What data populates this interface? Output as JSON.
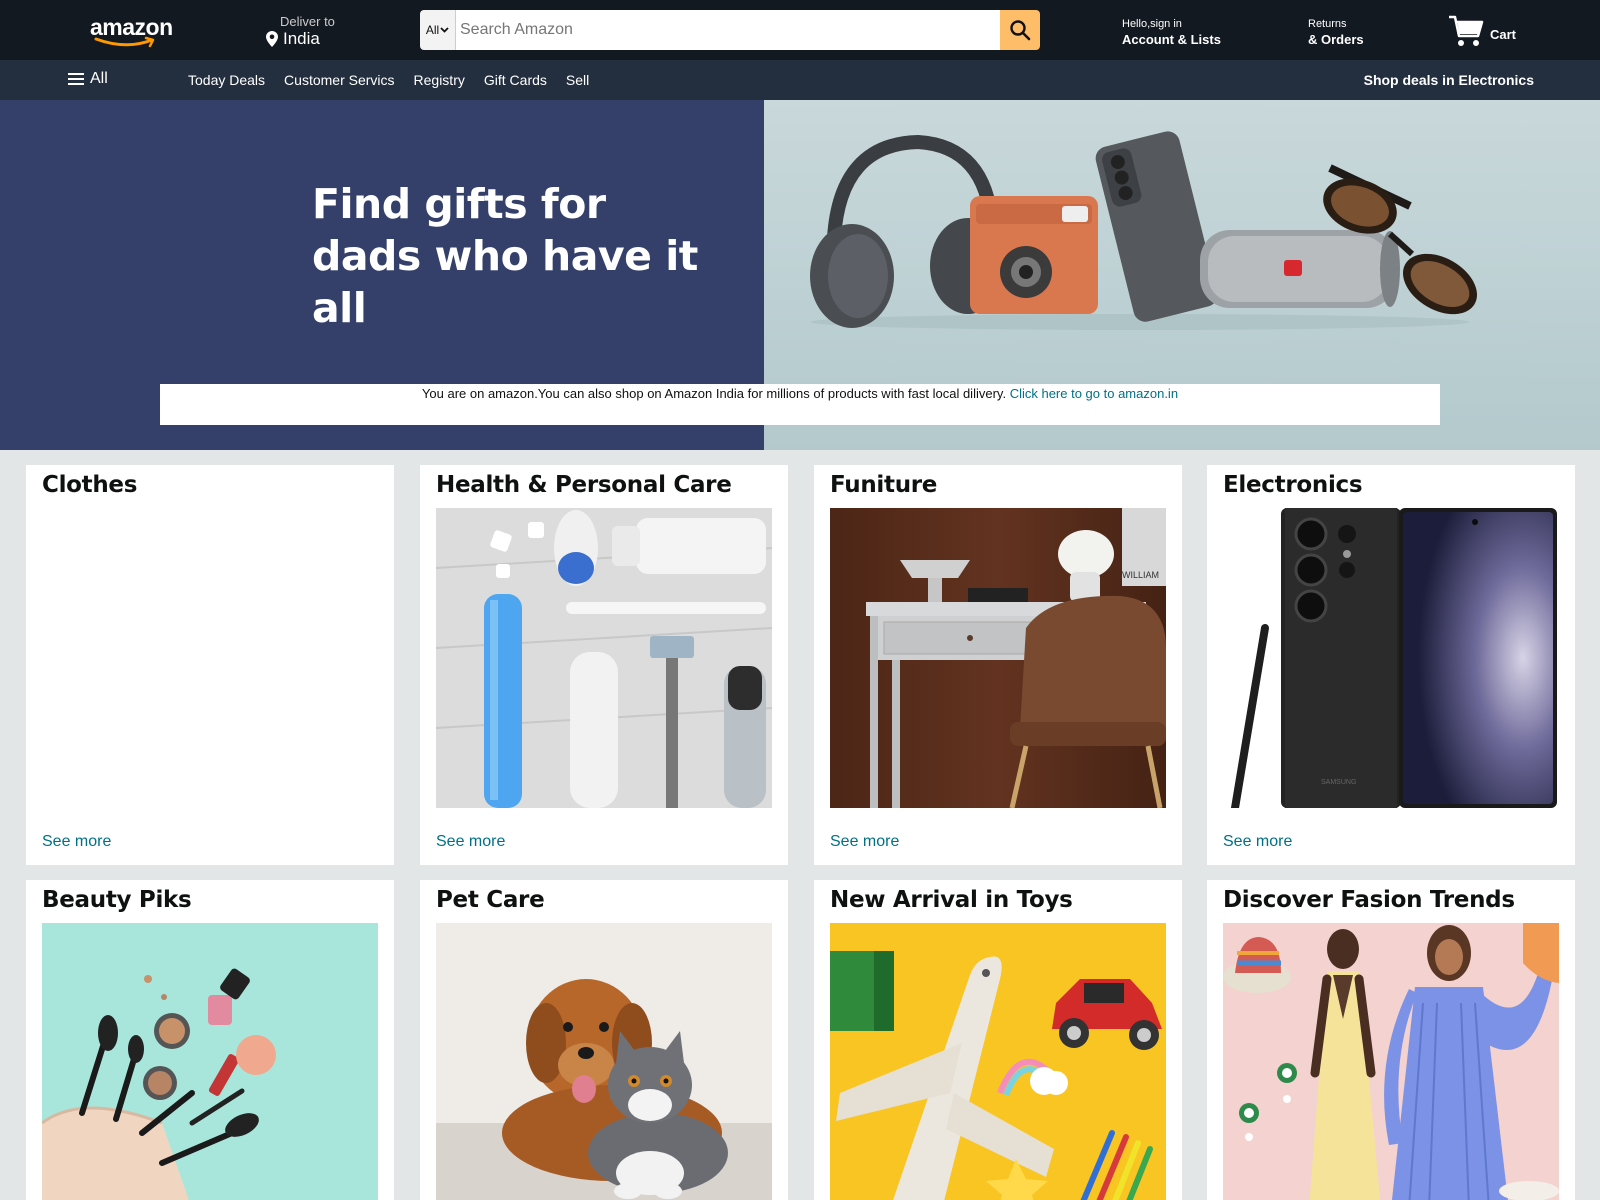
{
  "header": {
    "logo_text": "amazon",
    "deliver_label": "Deliver to",
    "deliver_location": "India",
    "search_category": "All",
    "search_placeholder": "Search Amazon",
    "account_greeting": "Hello,sign in",
    "account_label": "Account & Lists",
    "returns_label": "Returns",
    "orders_label": "& Orders",
    "cart_label": "Cart"
  },
  "subnav": {
    "all_label": "All",
    "links": [
      "Today Deals",
      "Customer Servics",
      "Registry",
      "Gift Cards",
      "Sell"
    ],
    "promo": "Shop deals in Electronics"
  },
  "hero": {
    "heading_line1": "Find gifts for",
    "heading_line2": "dads who have it all"
  },
  "notice": {
    "text": "You are on amazon.You can also shop on Amazon India for millions of products with fast local dilivery.",
    "link_text": "Click here to go to amazon.in"
  },
  "cards": [
    {
      "title": "Clothes",
      "see_more": "See more"
    },
    {
      "title": "Health & Personal Care",
      "see_more": "See more"
    },
    {
      "title": "Funiture",
      "see_more": "See more"
    },
    {
      "title": "Electronics",
      "see_more": "See more"
    },
    {
      "title": "Beauty Piks"
    },
    {
      "title": "Pet Care"
    },
    {
      "title": "New Arrival in Toys"
    },
    {
      "title": "Discover Fasion Trends"
    }
  ],
  "furniture_book_text": "WILLIAM",
  "phone_brand_text": "SAMSUNG",
  "colors": {
    "nav_bg": "#131921",
    "subnav_bg": "#232f3e",
    "search_button": "#febd69",
    "link": "#007185",
    "hero_left": "#34406a"
  }
}
